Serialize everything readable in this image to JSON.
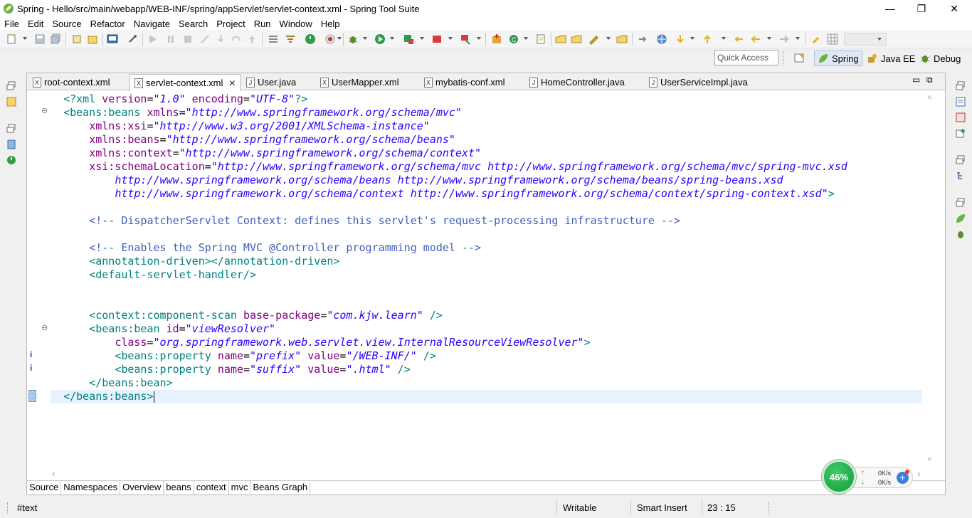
{
  "window": {
    "title": "Spring - Hello/src/main/webapp/WEB-INF/spring/appServlet/servlet-context.xml - Spring Tool Suite",
    "minimize": "—",
    "restore": "❐",
    "close": "✕"
  },
  "menu": [
    "File",
    "Edit",
    "Source",
    "Refactor",
    "Navigate",
    "Search",
    "Project",
    "Run",
    "Window",
    "Help"
  ],
  "quick_access": {
    "placeholder": "Quick Access"
  },
  "perspectives": [
    {
      "label": "Spring",
      "icon": "spring-leaf-icon",
      "active": true
    },
    {
      "label": "Java EE",
      "icon": "java-ee-icon",
      "active": false
    },
    {
      "label": "Debug",
      "icon": "debug-bug-icon",
      "active": false
    }
  ],
  "tabs": [
    {
      "label": "root-context.xml",
      "icon": "X"
    },
    {
      "label": "servlet-context.xml",
      "icon": "X",
      "active": true,
      "close": "✕"
    },
    {
      "label": "User.java",
      "icon": "J"
    },
    {
      "label": "UserMapper.xml",
      "icon": "X"
    },
    {
      "label": "mybatis-conf.xml",
      "icon": "X"
    },
    {
      "label": "HomeController.java",
      "icon": "J"
    },
    {
      "label": "UserServiceImpl.java",
      "icon": "J"
    }
  ],
  "code": {
    "l1_pi": "<?xml ",
    "l1_a1": "version",
    "l1_v1": "\"1.0\"",
    "l1_a2": " encoding",
    "l1_v2": "\"UTF-8\"",
    "l1_end": "?>",
    "l2_tag": "<beans:beans ",
    "l2_attr": "xmlns",
    "l2_val": "\"http://www.springframework.org/schema/mvc\"",
    "l3_attr": "xmlns:xsi",
    "l3_val": "\"http://www.w3.org/2001/XMLSchema-instance\"",
    "l4_attr": "xmlns:beans",
    "l4_val": "\"http://www.springframework.org/schema/beans\"",
    "l5_attr": "xmlns:context",
    "l5_val": "\"http://www.springframework.org/schema/context\"",
    "l6_attr": "xsi:schemaLocation",
    "l6_val": "\"http://www.springframework.org/schema/mvc http://www.springframework.org/schema/mvc/spring-mvc.xsd",
    "l7_val": "http://www.springframework.org/schema/beans http://www.springframework.org/schema/beans/spring-beans.xsd",
    "l8_val": "http://www.springframework.org/schema/context http://www.springframework.org/schema/context/spring-context.xsd\"",
    "l8_end": ">",
    "l10": "<!-- DispatcherServlet Context: defines this servlet's request-processing infrastructure -->",
    "l12": "<!-- Enables the Spring MVC @Controller programming model -->",
    "l13": "<annotation-driven></annotation-driven>",
    "l14": "<default-servlet-handler/>",
    "l17_tag": "<context:component-scan ",
    "l17_attr": "base-package",
    "l17_val": "\"com.kjw.learn\"",
    "l17_end": " />",
    "l18_tag": "<beans:bean ",
    "l18_attr": "id",
    "l18_val": "\"viewResolver\"",
    "l19_attr": "class",
    "l19_val": "\"org.springframework.web.servlet.view.InternalResourceViewResolver\"",
    "l19_end": ">",
    "l20_tag": "<beans:property ",
    "l20_a1": "name",
    "l20_v1": "\"prefix\"",
    "l20_a2": " value",
    "l20_v2": "\"/WEB-INF/\"",
    "l20_end": " />",
    "l21_tag": "<beans:property ",
    "l21_a1": "name",
    "l21_v1": "\"suffix\"",
    "l21_a2": " value",
    "l21_v2": "\".html\"",
    "l21_end": " />",
    "l22": "</beans:bean>",
    "l23": "</beans:beans>",
    "eq": "="
  },
  "page_tabs": [
    "Source",
    "Namespaces",
    "Overview",
    "beans",
    "context",
    "mvc",
    "Beans Graph"
  ],
  "status": {
    "selection": "#text",
    "writable": "Writable",
    "insert_mode": "Smart Insert",
    "position": "23 : 15"
  },
  "net_monitor": {
    "percent": "46%",
    "up": "0K/s",
    "down": "0K/s",
    "up_arrow": "↑",
    "down_arrow": "↓",
    "plus": "+"
  },
  "ruler_markers": {
    "fold": "⊖",
    "info": "i"
  },
  "scroll_arrows": {
    "up": "˄",
    "down": "˅",
    "left": "‹",
    "right": "›"
  },
  "colors": {
    "tag": "#008080",
    "attribute": "#7f007f",
    "value": "#2a00ff",
    "comment": "#3f5fbf",
    "current_line": "#e8f2fe",
    "accent": "#139a3c"
  }
}
